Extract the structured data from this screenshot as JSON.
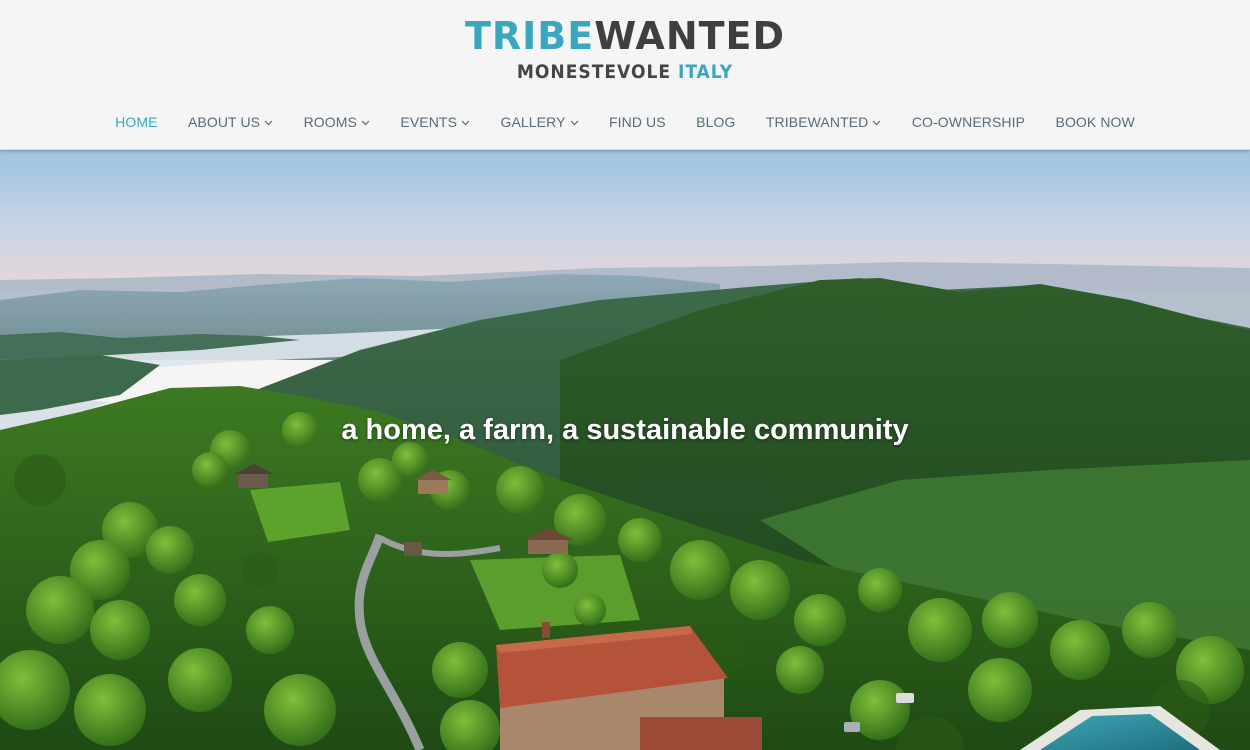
{
  "logo": {
    "part1": "TRIBE",
    "part2": "WANTED",
    "sub1": "MONESTEVOLE",
    "sub2": "ITALY"
  },
  "nav": [
    {
      "label": "HOME",
      "active": true,
      "dropdown": false
    },
    {
      "label": "ABOUT US",
      "active": false,
      "dropdown": true
    },
    {
      "label": "ROOMS",
      "active": false,
      "dropdown": true
    },
    {
      "label": "EVENTS",
      "active": false,
      "dropdown": true
    },
    {
      "label": "GALLERY",
      "active": false,
      "dropdown": true
    },
    {
      "label": "FIND US",
      "active": false,
      "dropdown": false
    },
    {
      "label": "BLOG",
      "active": false,
      "dropdown": false
    },
    {
      "label": "TRIBEWANTED",
      "active": false,
      "dropdown": true
    },
    {
      "label": "CO-OWNERSHIP",
      "active": false,
      "dropdown": false
    },
    {
      "label": "BOOK NOW",
      "active": false,
      "dropdown": false
    }
  ],
  "hero": {
    "tagline": "a home, a farm, a sustainable community"
  },
  "colors": {
    "accent": "#3aa6bf",
    "nav_text": "#5a6b77",
    "header_bg": "#f5f5f5"
  }
}
